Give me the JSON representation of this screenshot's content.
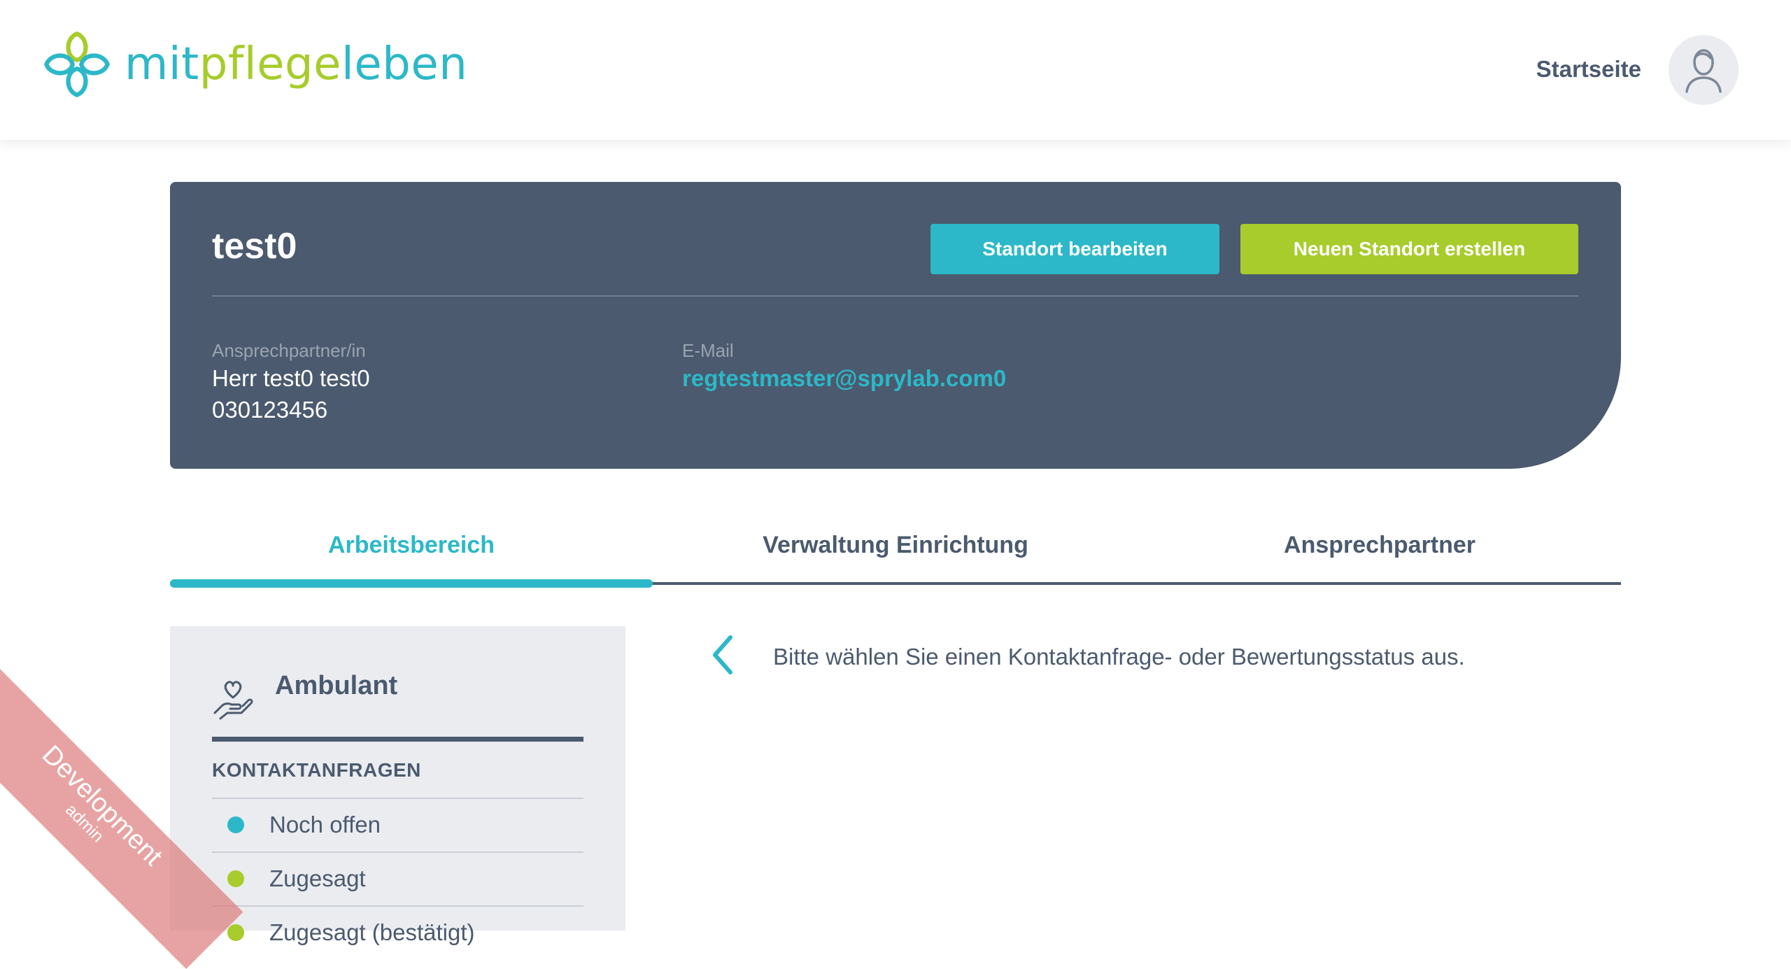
{
  "header": {
    "logo": {
      "part1": "mit",
      "part2": "pflege",
      "part3": "leben"
    },
    "nav_home": "Startseite",
    "icons": {
      "logo": "clover-logo-icon",
      "avatar": "user-avatar-icon"
    }
  },
  "location": {
    "name": "test0",
    "edit_button": "Standort bearbeiten",
    "new_button": "Neuen Standort erstellen",
    "contact_label": "Ansprechpartner/in",
    "contact_name": "Herr test0 test0",
    "contact_phone": "030123456",
    "email_label": "E-Mail",
    "email_value": "regtestmaster@sprylab.com0"
  },
  "tabs": [
    {
      "label": "Arbeitsbereich",
      "active": true
    },
    {
      "label": "Verwaltung Einrichtung",
      "active": false
    },
    {
      "label": "Ansprechpartner",
      "active": false
    }
  ],
  "sidebar": {
    "care_type": "Ambulant",
    "care_icon": "heart-hand-icon",
    "section_title": "KONTAKTANFRAGEN",
    "statuses": [
      {
        "label": "Noch offen",
        "color": "#2cb8c8"
      },
      {
        "label": "Zugesagt",
        "color": "#a7cc2b"
      },
      {
        "label": "Zugesagt (bestätigt)",
        "color": "#a7cc2b"
      }
    ]
  },
  "main": {
    "hint_icon": "chevron-left-icon",
    "hint": "Bitte wählen Sie einen Kontaktanfrage- oder Bewertungsstatus aus."
  },
  "environment": {
    "label": "Development",
    "role": "admin"
  },
  "colors": {
    "primary": "#2cb8c8",
    "accent": "#a7cc2b",
    "dark": "#4b5a6e",
    "sidebar_bg": "#eaecf0"
  }
}
